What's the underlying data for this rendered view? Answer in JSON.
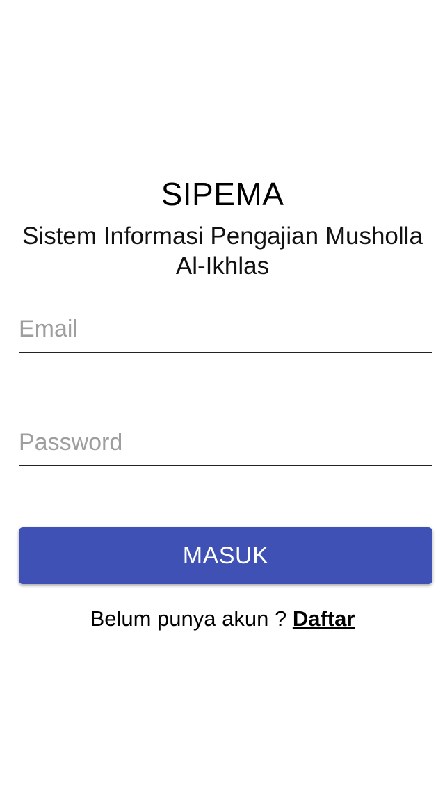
{
  "app": {
    "title": "SIPEMA",
    "subtitle": "Sistem Informasi Pengajian Musholla Al-Ikhlas"
  },
  "form": {
    "email_placeholder": "Email",
    "email_value": "",
    "password_placeholder": "Password",
    "password_value": "",
    "submit_label": "MASUK"
  },
  "register": {
    "prompt": "Belum punya akun ? ",
    "link_label": "Daftar"
  },
  "colors": {
    "accent": "#3F51B5",
    "placeholder": "#9E9E9E"
  }
}
